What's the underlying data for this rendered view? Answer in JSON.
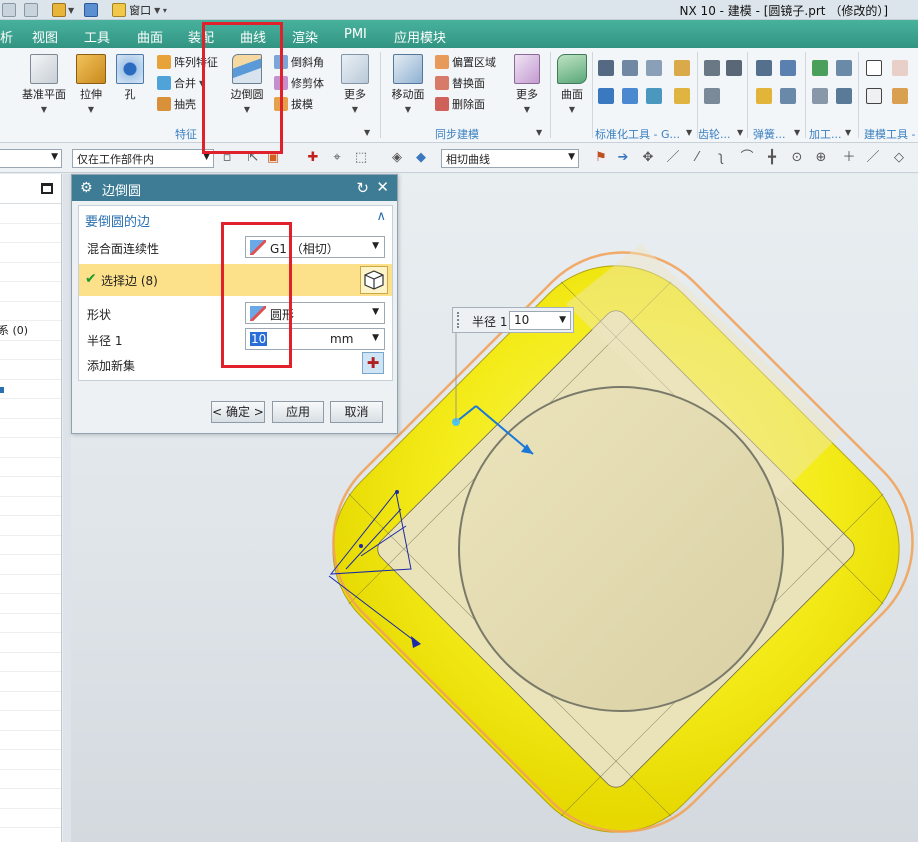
{
  "window": {
    "title": "NX 10 - 建模 - [圆镜子.prt （修改的）]",
    "quick_access_window": "窗口"
  },
  "menu": [
    "析",
    "视图",
    "工具",
    "曲面",
    "装配",
    "曲线",
    "渲染",
    "PMI",
    "应用模块"
  ],
  "ribbon": {
    "datum_plane": "基准平面",
    "extrude": "拉伸",
    "hole": "孔",
    "pattern_feature": "阵列特征",
    "unite": "合并",
    "shell": "抽壳",
    "edge_blend": "边倒圆",
    "chamfer": "倒斜角",
    "trim_body": "修剪体",
    "draft": "拔模",
    "more_1": "更多",
    "move_face": "移动面",
    "offset_region": "偏置区域",
    "replace_face": "替换面",
    "delete_face": "删除面",
    "more_2": "更多",
    "surface": "曲面",
    "group_feature": "特征",
    "group_sync": "同步建模",
    "group_std_tools": "标准化工具 - G...",
    "group_gear": "齿轮...",
    "group_spring": "弹簧...",
    "group_machining": "加工...",
    "group_modeling_tools": "建模工具 -"
  },
  "filterbar": {
    "scope": "仅在工作部件内",
    "curve_rule": "相切曲线"
  },
  "navigator": {
    "row_label": "系 (0)"
  },
  "dialog": {
    "title": "边倒圆",
    "section": "要倒圆的边",
    "continuity_label": "混合面连续性",
    "continuity_value": "G1 （相切）",
    "select_edge": "选择边 (8)",
    "shape_label": "形状",
    "shape_value": "圆形",
    "radius_label": "半径 1",
    "radius_value": "10",
    "radius_unit": "mm",
    "add_set_label": "添加新集",
    "ok": "< 确定 >",
    "apply": "应用",
    "cancel": "取消"
  },
  "float_radius": {
    "label": "半径 1",
    "value": "10"
  },
  "colors": {
    "menubar": "#38a08c",
    "dialog_title": "#3e7b94",
    "selected_row": "#fde08a",
    "highlight_red": "#e0202a",
    "model_yellow": "#f6ee1e",
    "preview_orange": "#f2a35a"
  }
}
